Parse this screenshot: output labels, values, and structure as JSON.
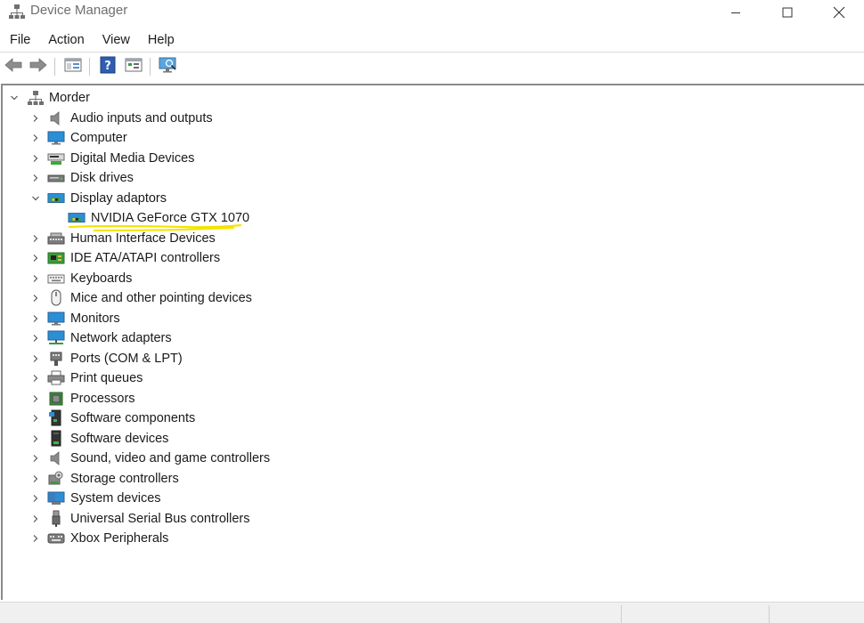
{
  "window": {
    "title": "Device Manager",
    "icon": "device-manager-icon",
    "controls": [
      "minimize-icon",
      "maximize-icon",
      "close-icon"
    ]
  },
  "menu": [
    {
      "label": "File"
    },
    {
      "label": "Action"
    },
    {
      "label": "View"
    },
    {
      "label": "Help"
    }
  ],
  "toolbar": [
    {
      "name": "back-button",
      "icon": "back-arrow-icon"
    },
    {
      "name": "forward-button",
      "icon": "forward-arrow-icon"
    },
    {
      "name": "show-hide-console-tree-button",
      "icon": "console-tree-icon"
    },
    {
      "name": "help-button",
      "icon": "help-icon"
    },
    {
      "name": "properties-button",
      "icon": "properties-icon"
    },
    {
      "name": "scan-hardware-button",
      "icon": "scan-monitor-icon"
    }
  ],
  "tree": {
    "root": {
      "label": "Morder",
      "icon": "computer-network-icon",
      "expanded": true
    },
    "categories": [
      {
        "label": "Audio inputs and outputs",
        "icon": "speaker-icon",
        "expanded": false
      },
      {
        "label": "Computer",
        "icon": "monitor-icon",
        "expanded": false
      },
      {
        "label": "Digital Media Devices",
        "icon": "media-device-icon",
        "expanded": false
      },
      {
        "label": "Disk drives",
        "icon": "disk-drive-icon",
        "expanded": false
      },
      {
        "label": "Display adaptors",
        "icon": "display-adapter-icon",
        "expanded": true,
        "children": [
          {
            "label": "NVIDIA GeForce GTX 1070",
            "icon": "display-adapter-icon",
            "highlighted": true
          }
        ]
      },
      {
        "label": "Human Interface Devices",
        "icon": "hid-icon",
        "expanded": false
      },
      {
        "label": "IDE ATA/ATAPI controllers",
        "icon": "ide-controller-icon",
        "expanded": false
      },
      {
        "label": "Keyboards",
        "icon": "keyboard-icon",
        "expanded": false
      },
      {
        "label": "Mice and other pointing devices",
        "icon": "mouse-icon",
        "expanded": false
      },
      {
        "label": "Monitors",
        "icon": "monitor-icon",
        "expanded": false
      },
      {
        "label": "Network adapters",
        "icon": "network-adapter-icon",
        "expanded": false
      },
      {
        "label": "Ports (COM & LPT)",
        "icon": "port-icon",
        "expanded": false
      },
      {
        "label": "Print queues",
        "icon": "printer-icon",
        "expanded": false
      },
      {
        "label": "Processors",
        "icon": "processor-icon",
        "expanded": false
      },
      {
        "label": "Software components",
        "icon": "software-component-icon",
        "expanded": false
      },
      {
        "label": "Software devices",
        "icon": "software-device-icon",
        "expanded": false
      },
      {
        "label": "Sound, video and game controllers",
        "icon": "speaker-icon",
        "expanded": false
      },
      {
        "label": "Storage controllers",
        "icon": "storage-controller-icon",
        "expanded": false
      },
      {
        "label": "System devices",
        "icon": "system-device-icon",
        "expanded": false
      },
      {
        "label": "Universal Serial Bus controllers",
        "icon": "usb-icon",
        "expanded": false
      },
      {
        "label": "Xbox Peripherals",
        "icon": "gamepad-icon",
        "expanded": false
      }
    ]
  },
  "colors": {
    "highlight": "#f5e400",
    "icon_blue": "#2b8fd6",
    "icon_gray": "#6d6d6d"
  }
}
